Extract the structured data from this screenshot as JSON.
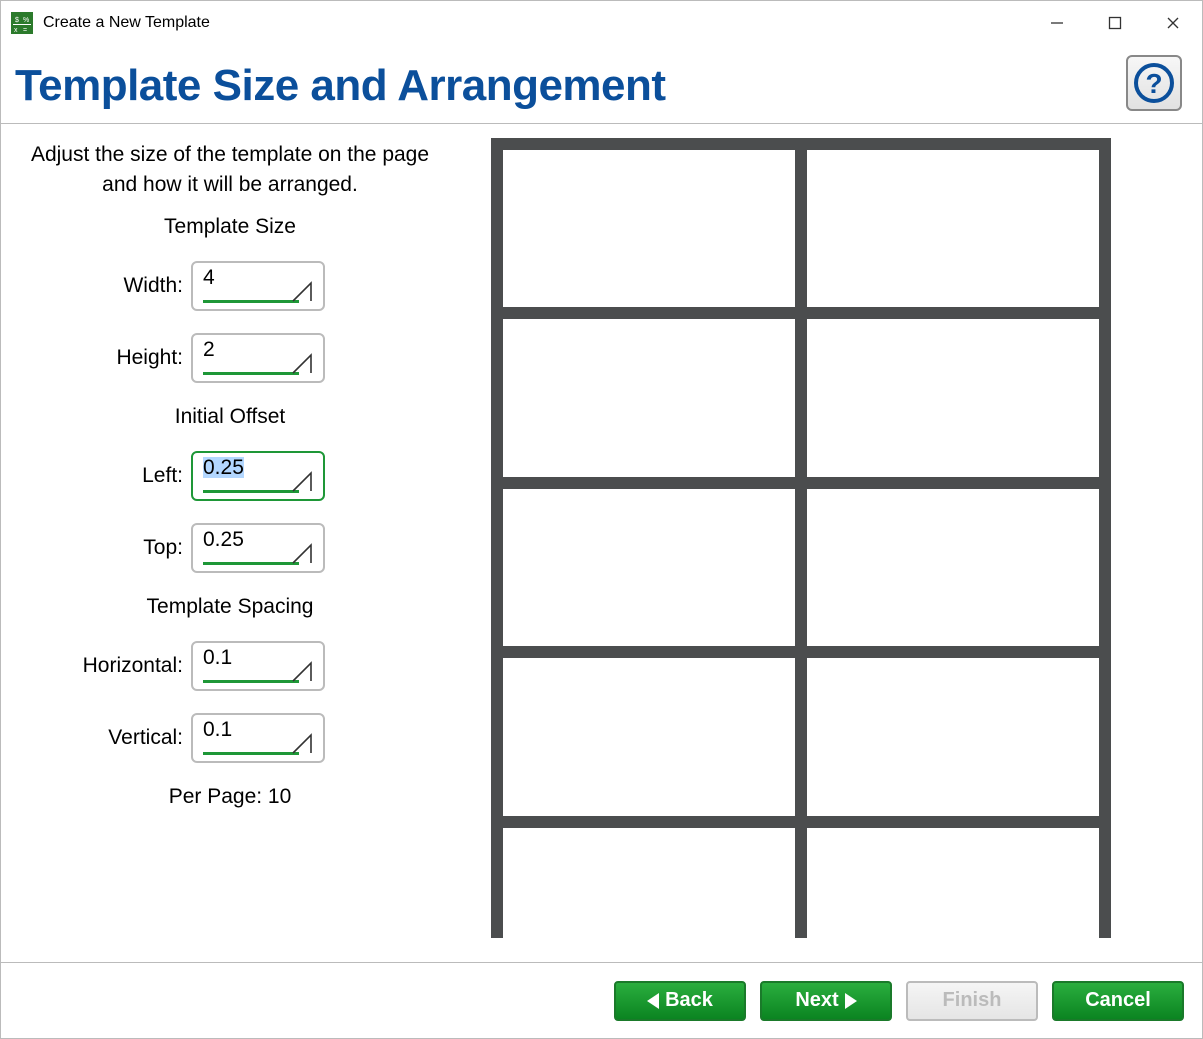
{
  "window": {
    "title": "Create a New Template",
    "app_icon": "money-icon"
  },
  "header": {
    "title": "Template Size and Arrangement"
  },
  "intro": "Adjust the size of the template on the page and how it will be arranged.",
  "sections": {
    "template_size": {
      "title": "Template Size",
      "width_label": "Width:",
      "width_value": "4",
      "height_label": "Height:",
      "height_value": "2"
    },
    "initial_offset": {
      "title": "Initial Offset",
      "left_label": "Left:",
      "left_value": "0.25",
      "left_selected": true,
      "top_label": "Top:",
      "top_value": "0.25"
    },
    "template_spacing": {
      "title": "Template Spacing",
      "horizontal_label": "Horizontal:",
      "horizontal_value": "0.1",
      "vertical_label": "Vertical:",
      "vertical_value": "0.1"
    },
    "per_page": "Per Page: 10"
  },
  "preview": {
    "rows": 5,
    "cols": 2,
    "last_row_clipped": true
  },
  "buttons": {
    "back": "Back",
    "next": "Next",
    "finish": "Finish",
    "cancel": "Cancel"
  }
}
